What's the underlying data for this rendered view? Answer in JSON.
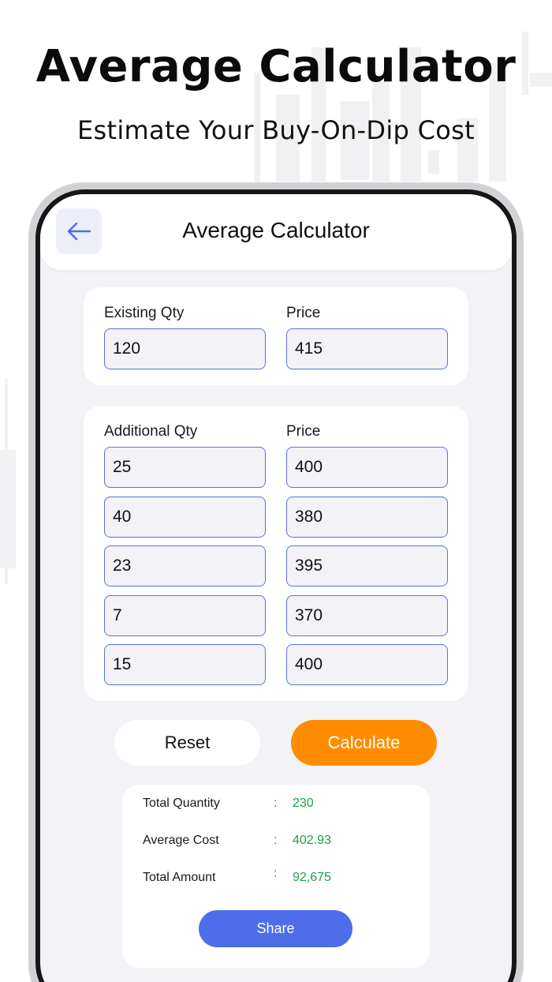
{
  "promo": {
    "title": "Average Calculator",
    "subtitle": "Estimate Your Buy-On-Dip Cost"
  },
  "header": {
    "title": "Average Calculator",
    "back_icon": "arrow-left-icon"
  },
  "existing": {
    "qty_label": "Existing Qty",
    "price_label": "Price",
    "qty_value": "120",
    "price_value": "415"
  },
  "additional": {
    "qty_label": "Additional Qty",
    "price_label": "Price",
    "rows": [
      {
        "qty": "25",
        "price": "400"
      },
      {
        "qty": "40",
        "price": "380"
      },
      {
        "qty": "23",
        "price": "395"
      },
      {
        "qty": "7",
        "price": "370"
      },
      {
        "qty": "15",
        "price": "400"
      }
    ]
  },
  "actions": {
    "reset_label": "Reset",
    "calculate_label": "Calculate"
  },
  "results": {
    "total_quantity_label": "Total Quantity",
    "total_quantity_value": "230",
    "average_cost_label": "Average Cost",
    "average_cost_value": "402.93",
    "total_amount_label": "Total Amount",
    "total_amount_value": "92,675",
    "separator": ":",
    "share_label": "Share"
  },
  "colors": {
    "accent_blue": "#4d6ee8",
    "calculate_orange": "#ff8c00",
    "result_green": "#17a34a",
    "field_border": "#5b73d9"
  }
}
